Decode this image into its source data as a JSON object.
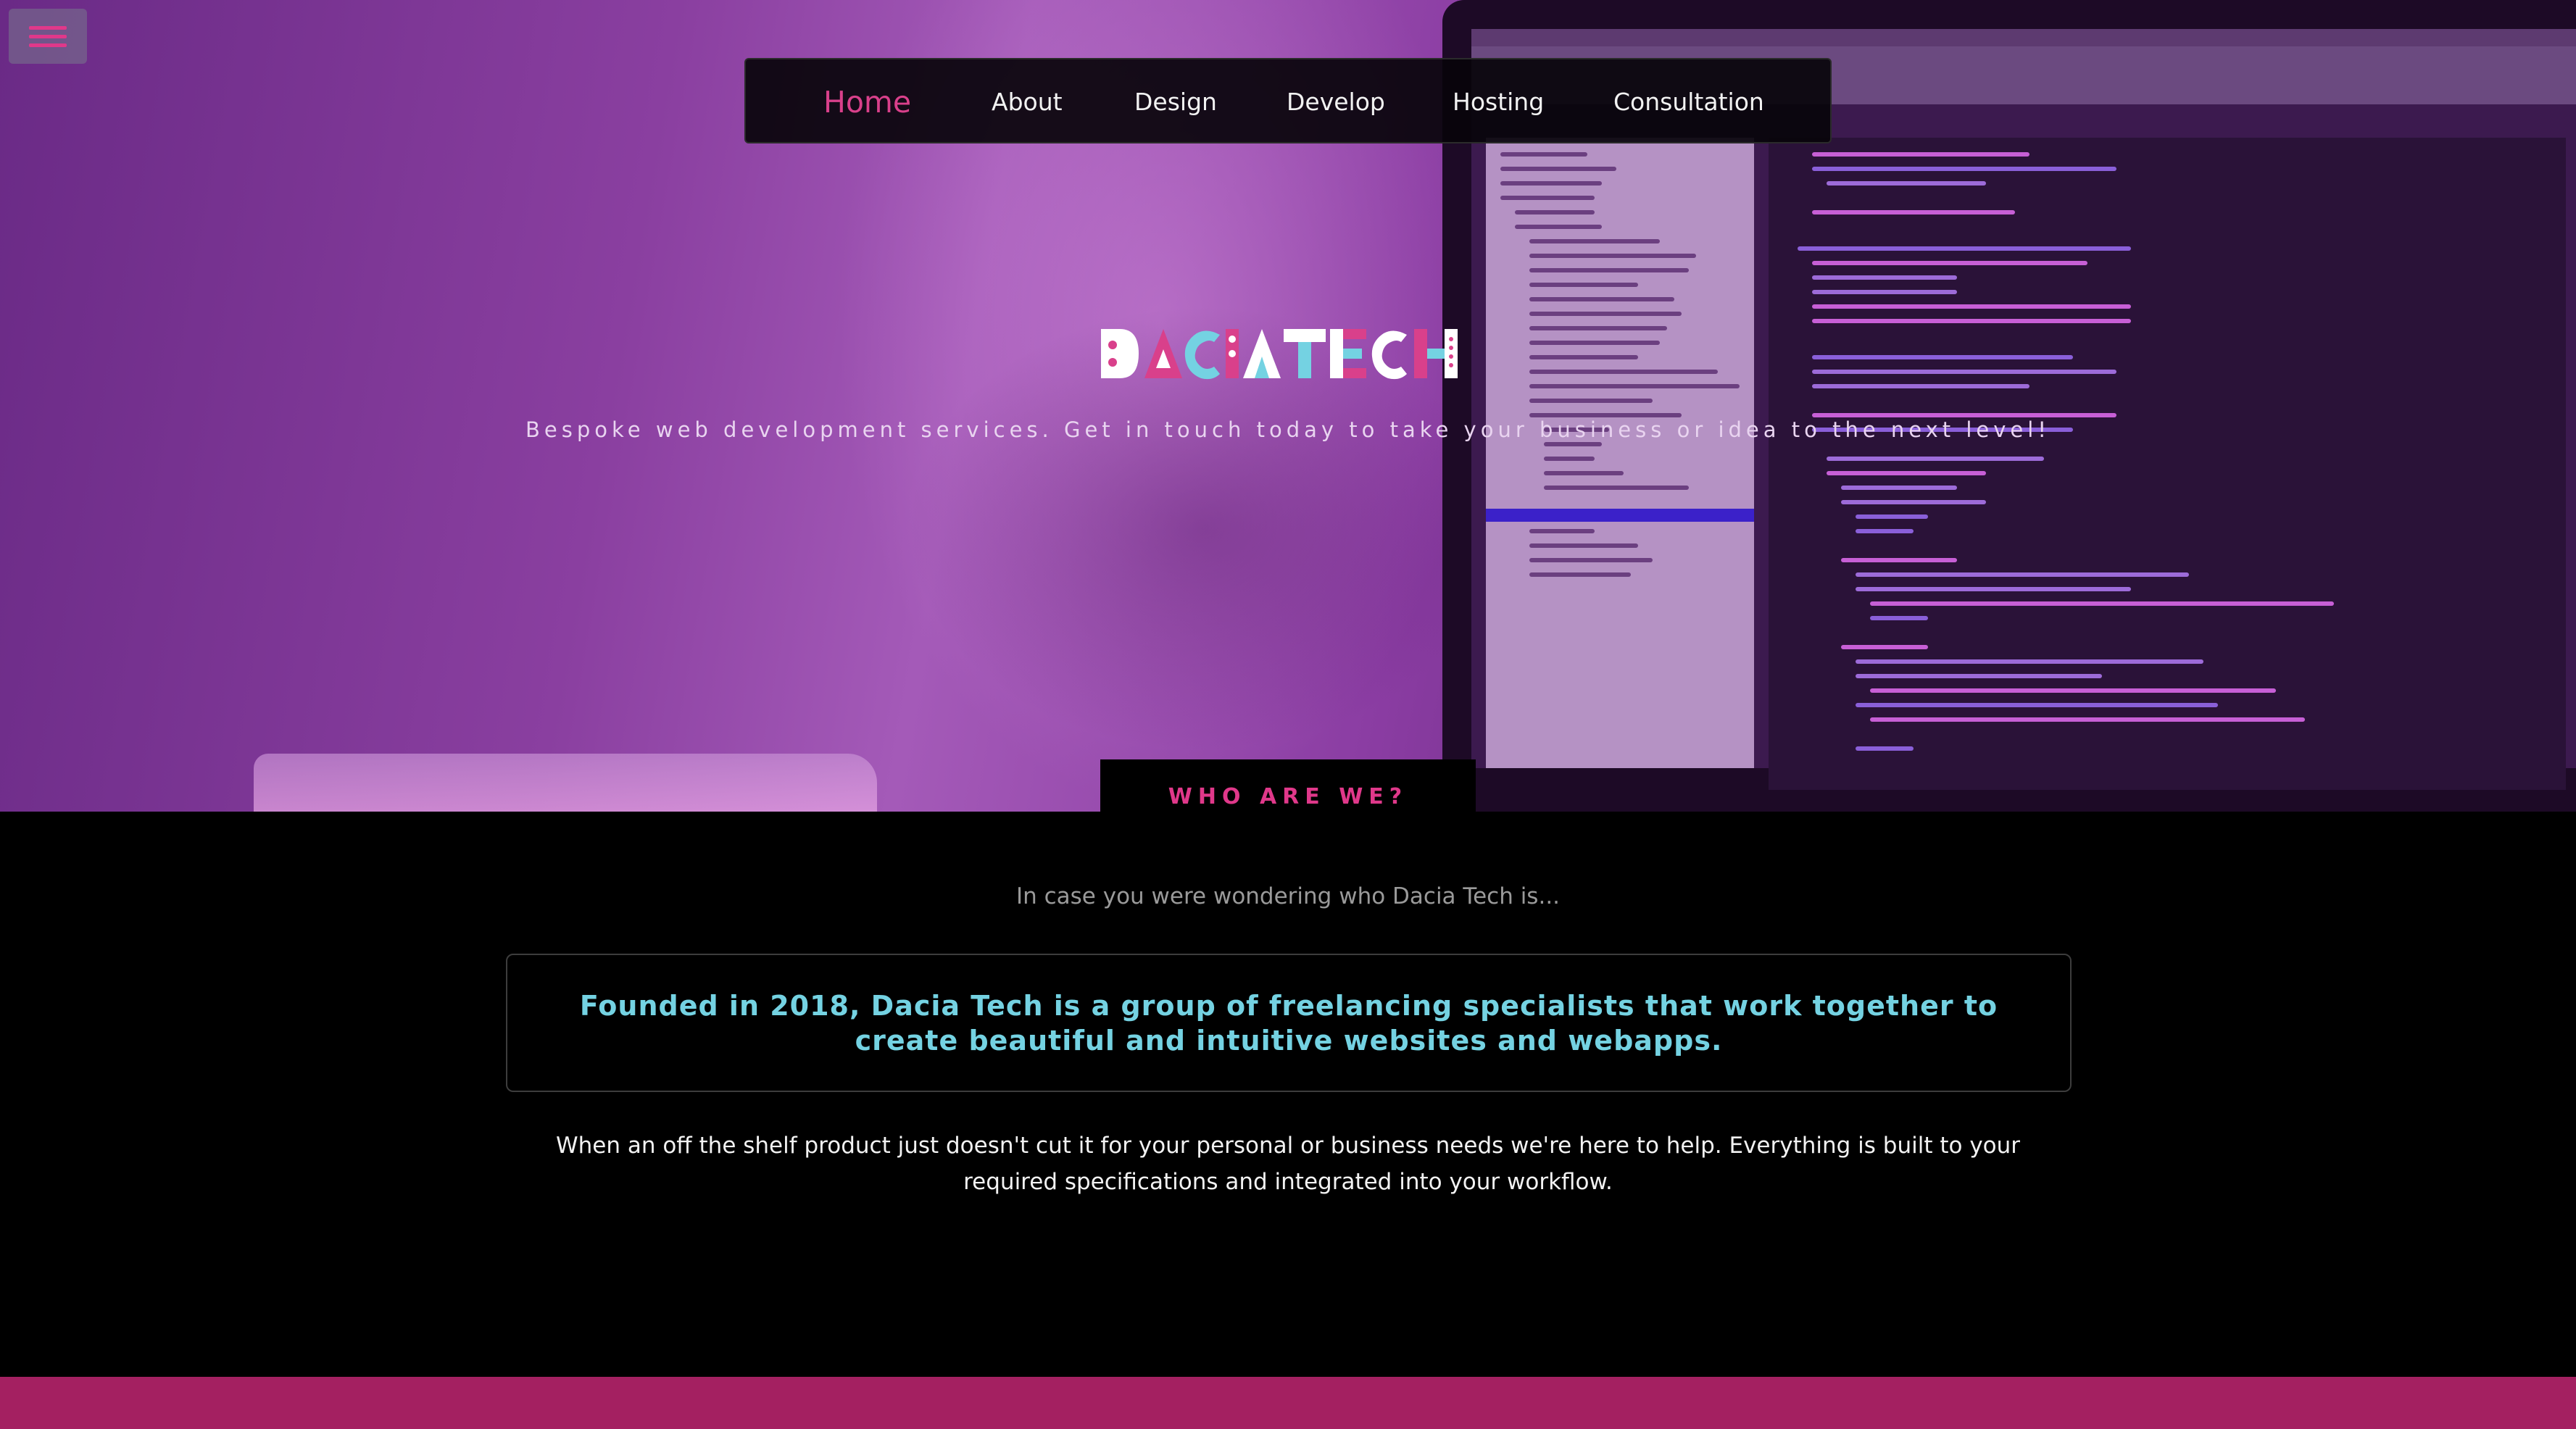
{
  "colors": {
    "accent_pink": "#e0388a",
    "active_nav": "#d9408b",
    "highlight_cyan": "#74d2e2",
    "footer": "#a42061",
    "background": "#000000"
  },
  "menu_button": {
    "icon": "hamburger-icon"
  },
  "nav": {
    "items": [
      {
        "label": "Home",
        "active": true
      },
      {
        "label": "About"
      },
      {
        "label": "Design"
      },
      {
        "label": "Develop"
      },
      {
        "label": "Hosting"
      },
      {
        "label": "Consultation"
      }
    ]
  },
  "hero": {
    "logo_text": "DACIATECH",
    "tagline": "Bespoke web development services. Get in touch today to take your business or idea to the next level!"
  },
  "about": {
    "tab_label": "WHO ARE WE?",
    "intro": "In case you were wondering who Dacia Tech is...",
    "highlight": "Founded in 2018, Dacia Tech is a group of freelancing specialists that work together to create beautiful and intuitive websites and webapps.",
    "body": "When an off the shelf product just doesn't cut it for your personal or business needs we're here to help. Everything is built to your required specifications and integrated into your workflow."
  }
}
